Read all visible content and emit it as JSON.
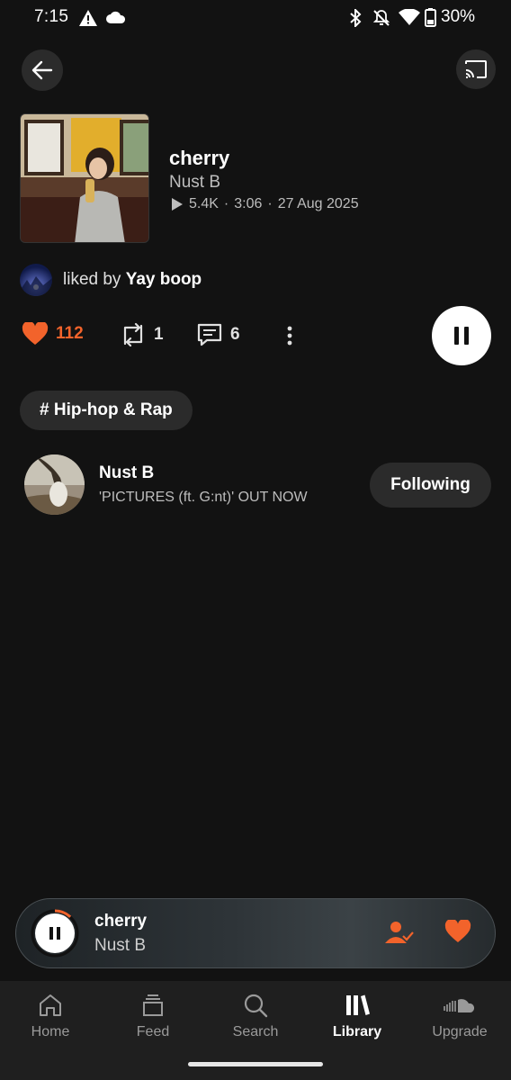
{
  "status_bar": {
    "time": "7:15",
    "battery": "30%",
    "icons": [
      "warning-icon",
      "cloud-icon",
      "bluetooth-icon",
      "notifications-off-icon",
      "wifi-icon",
      "battery-icon"
    ]
  },
  "header": {
    "back_icon": "arrow-left-icon",
    "cast_icon": "cast-icon"
  },
  "track": {
    "title": "cherry",
    "artist": "Nust B",
    "plays": "5.4K",
    "duration": "3:06",
    "date": "27 Aug 2025",
    "meta_separator": "·"
  },
  "liked_by": {
    "prefix": "liked by",
    "user": "Yay boop"
  },
  "actions": {
    "likes": "112",
    "reposts": "1",
    "comments": "6"
  },
  "genre_tag": "# Hip-hop & Rap",
  "artist_card": {
    "name": "Nust B",
    "status": "'PICTURES (ft. G:nt)' OUT NOW",
    "follow_label": "Following"
  },
  "mini_player": {
    "title": "cherry",
    "artist": "Nust B",
    "progress": 0.12
  },
  "nav": {
    "items": [
      {
        "label": "Home",
        "icon": "home-icon",
        "active": false
      },
      {
        "label": "Feed",
        "icon": "feed-icon",
        "active": false
      },
      {
        "label": "Search",
        "icon": "search-icon",
        "active": false
      },
      {
        "label": "Library",
        "icon": "library-icon",
        "active": true
      },
      {
        "label": "Upgrade",
        "icon": "soundcloud-icon",
        "active": false
      }
    ]
  },
  "colors": {
    "accent": "#f2632b",
    "background": "#121212",
    "surface": "#2b2b2b"
  }
}
